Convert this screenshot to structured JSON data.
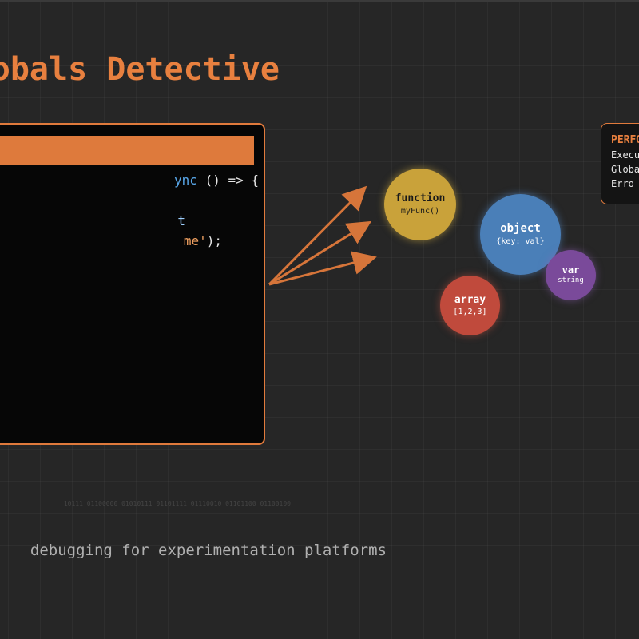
{
  "title": "obals Detective",
  "code": {
    "lines": [
      {
        "keyword": "ync",
        "punct": " () => {"
      },
      {
        "var": "t"
      },
      {
        "string": "me'",
        "punct": ");"
      }
    ]
  },
  "bubbles": {
    "function": {
      "label": "function",
      "sub": "myFunc()"
    },
    "object": {
      "label": "object",
      "sub": "{key: val}"
    },
    "array": {
      "label": "array",
      "sub": "[1,2,3]"
    },
    "var": {
      "label": "var",
      "sub": "string"
    }
  },
  "performance_panel": {
    "title": "PERFO",
    "rows": [
      "Execu",
      "Globa",
      "Erro"
    ]
  },
  "binary_text": "10111 01100000 01010111 01101111 01110010 01101100 01100100",
  "subtitle": "debugging for experimentation platforms",
  "colors": {
    "accent": "#e8803f",
    "background": "#262626",
    "function": "#c9a23a",
    "object": "#4a7fb8",
    "array": "#c04a3c",
    "var": "#7a4a9a"
  }
}
